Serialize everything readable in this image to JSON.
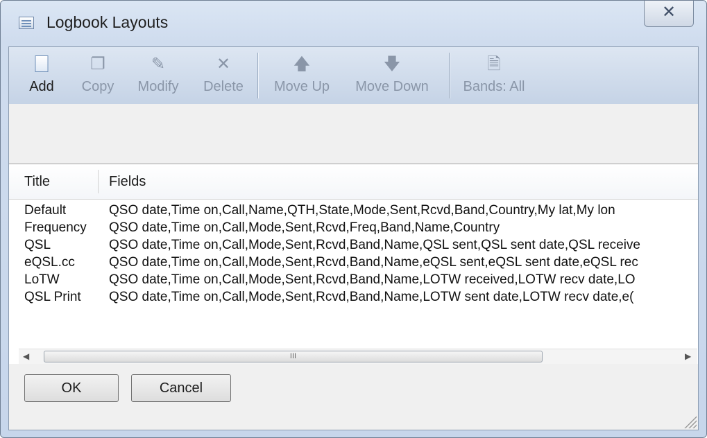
{
  "window": {
    "title": "Logbook Layouts",
    "close_glyph": "✕"
  },
  "toolbar": {
    "buttons": [
      {
        "label": "Add",
        "icon": "new-document-icon",
        "enabled": true
      },
      {
        "label": "Copy",
        "icon": "copy-icon",
        "enabled": false
      },
      {
        "label": "Modify",
        "icon": "modify-icon",
        "enabled": false
      },
      {
        "label": "Delete",
        "icon": "delete-icon",
        "enabled": false
      },
      {
        "label": "Move Up",
        "icon": "arrow-up-icon",
        "enabled": false
      },
      {
        "label": "Move Down",
        "icon": "arrow-down-icon",
        "enabled": false
      },
      {
        "label": "Bands: All",
        "icon": "bands-icon",
        "enabled": false
      }
    ]
  },
  "list": {
    "columns": [
      "Title",
      "Fields"
    ],
    "rows": [
      {
        "title": "Default",
        "fields": "QSO date,Time on,Call,Name,QTH,State,Mode,Sent,Rcvd,Band,Country,My lat,My lon"
      },
      {
        "title": "Frequency",
        "fields": "QSO date,Time on,Call,Mode,Sent,Rcvd,Freq,Band,Name,Country"
      },
      {
        "title": "QSL",
        "fields": "QSO date,Time on,Call,Mode,Sent,Rcvd,Band,Name,QSL sent,QSL sent date,QSL receive"
      },
      {
        "title": "eQSL.cc",
        "fields": "QSO date,Time on,Call,Mode,Sent,Rcvd,Band,Name,eQSL sent,eQSL sent date,eQSL rec"
      },
      {
        "title": "LoTW",
        "fields": "QSO date,Time on,Call,Mode,Sent,Rcvd,Band,Name,LOTW received,LOTW recv date,LO"
      },
      {
        "title": "QSL Print",
        "fields": "QSO date,Time on,Call,Mode,Sent,Rcvd,Band,Name,LOTW sent date,LOTW recv date,e("
      }
    ],
    "scroll_thumb_glyph": "III"
  },
  "footer": {
    "ok_label": "OK",
    "cancel_label": "Cancel"
  },
  "colors": {
    "frame": "#cfdcee",
    "toolbar": "#c5d3e6",
    "disabled_text": "#8a96a8"
  }
}
